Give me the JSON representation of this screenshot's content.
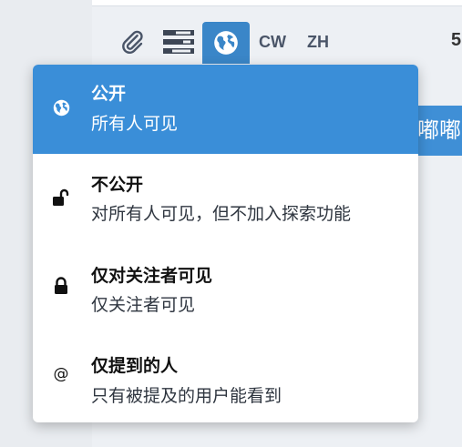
{
  "toolbar": {
    "attach_icon": "paperclip-icon",
    "poll_icon": "poll-icon",
    "visibility_icon": "globe-icon",
    "cw_label": "CW",
    "language_label": "ZH",
    "char_count": "5"
  },
  "publish_button": {
    "label": "嘟嘟"
  },
  "visibility_menu": {
    "options": [
      {
        "icon": "globe-icon",
        "title": "公开",
        "description": "所有人可见",
        "selected": true
      },
      {
        "icon": "unlock-icon",
        "title": "不公开",
        "description": "对所有人可见，但不加入探索功能",
        "selected": false
      },
      {
        "icon": "lock-icon",
        "title": "仅对关注者可见",
        "description": "仅关注者可见",
        "selected": false
      },
      {
        "icon": "at-icon",
        "title": "仅提到的人",
        "description": "只有被提及的用户能看到",
        "selected": false
      }
    ]
  },
  "colors": {
    "accent": "#3a8ed8",
    "background": "#e9ecf0",
    "menu": "#ffffff"
  }
}
